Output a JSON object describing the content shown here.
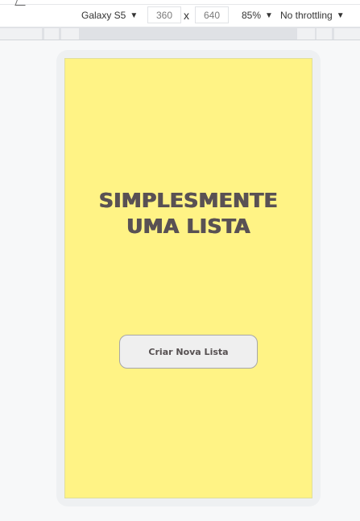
{
  "toolbar": {
    "device": "Galaxy S5",
    "width": "360",
    "height": "640",
    "dimension_separator": "x",
    "zoom": "85%",
    "throttling": "No throttling",
    "caret": "▼"
  },
  "app": {
    "title_line1": "SIMPLESMENTE",
    "title_line2": "UMA LISTA",
    "create_button_label": "Criar Nova Lista",
    "background_color": "#fff385",
    "text_color": "#595154"
  }
}
